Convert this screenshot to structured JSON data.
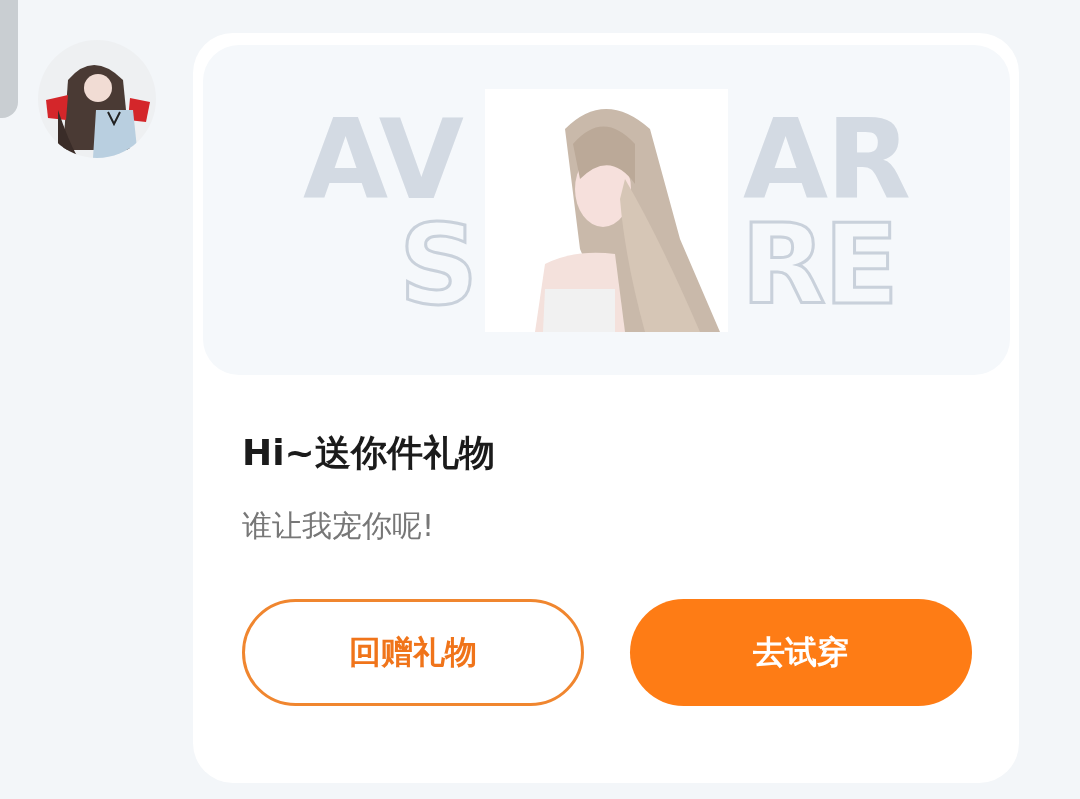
{
  "gift_card": {
    "banner": {
      "words": [
        {
          "text": "AV",
          "kind": "solid"
        },
        {
          "text": "AR",
          "kind": "solid"
        },
        {
          "text": "S",
          "kind": "outline"
        },
        {
          "text": "RE",
          "kind": "outline"
        }
      ]
    },
    "title": "Hi~送你件礼物",
    "message": "谁让我宠你呢!",
    "buttons": [
      {
        "label": "回赠礼物",
        "kind": "secondary"
      },
      {
        "label": "去试穿",
        "kind": "primary"
      }
    ]
  }
}
